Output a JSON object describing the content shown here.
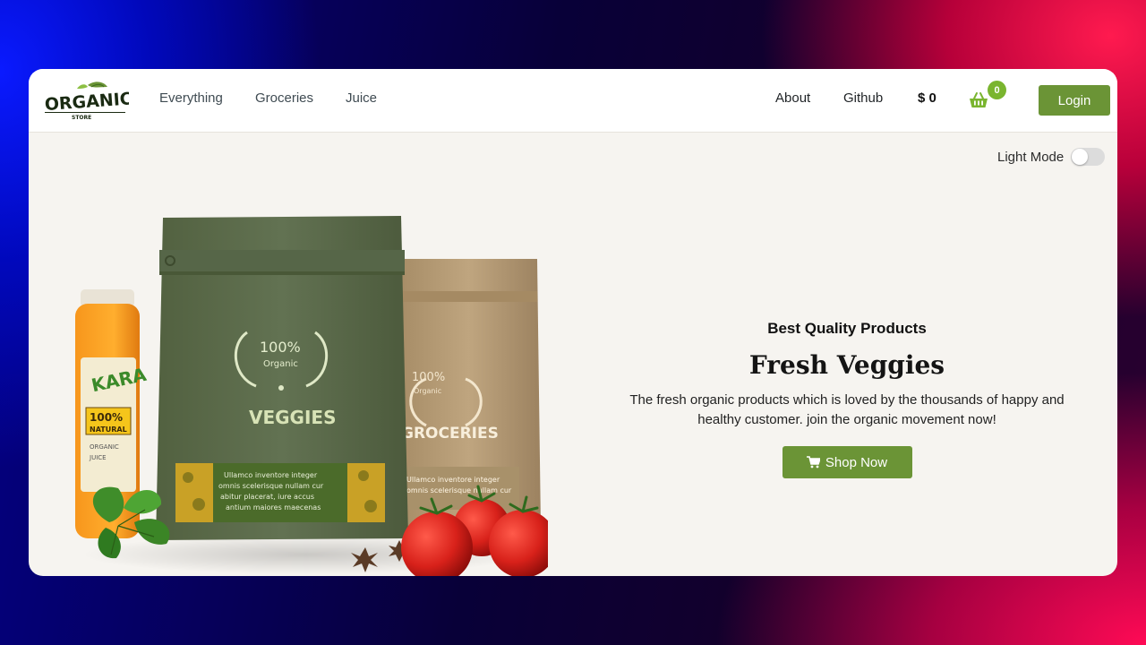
{
  "brand": {
    "logo_main": "ORGANIC",
    "logo_sub": "STORE"
  },
  "nav_left": [
    {
      "label": "Everything"
    },
    {
      "label": "Groceries"
    },
    {
      "label": "Juice"
    }
  ],
  "nav_right": {
    "about": "About",
    "github": "Github",
    "cash": "$ 0",
    "cart_count": "0",
    "login": "Login"
  },
  "theme": {
    "label": "Light Mode"
  },
  "hero": {
    "eyebrow": "Best Quality Products",
    "headline": "Fresh Veggies",
    "description": "The fresh organic products which is loved by the thousands of happy and healthy customer. join the organic movement now!",
    "cta": "Shop Now"
  },
  "product_art": {
    "bag1_badge": "100%",
    "bag1_badge_sub": "Organic",
    "bag1_title": "VEGGIES",
    "bag1_text": [
      "Ullamco inventore integer",
      "omnis scelerisque nullam cur",
      "abitur placerat, iure accus",
      "antium maiores maecenas"
    ],
    "bag2_badge": "100%",
    "bag2_badge_sub": "Organic",
    "bag2_title": "GROCERIES",
    "bag2_text": [
      "Ullamco inventore integer",
      "omnis scelerisque nullam cur"
    ],
    "jar_brand": "KARA",
    "jar_badge": "100%",
    "jar_sub": "NATURAL",
    "jar_lines": [
      "ORGANIC",
      "JUICE"
    ]
  },
  "colors": {
    "accent": "#6b9436",
    "badge": "#7ab52f",
    "bag_green": "#5e6e4a",
    "bag_kraft": "#b39a75"
  },
  "icons": {
    "cart": "basket-icon",
    "shop": "cart-icon",
    "toggle": "toggle-switch"
  }
}
